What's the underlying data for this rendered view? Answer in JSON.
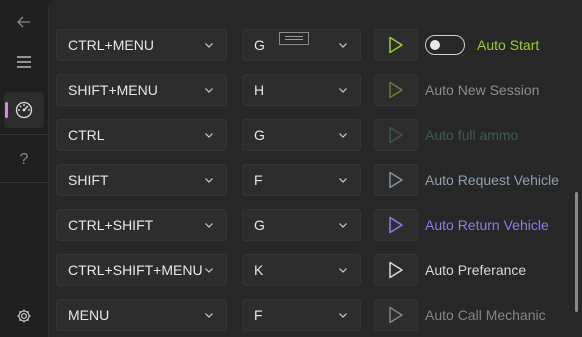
{
  "nav": {
    "back_icon": "back-arrow-icon",
    "menu_icon": "hamburger-menu-icon",
    "game_icon": "game-gauge-icon",
    "help_label": "?",
    "settings_icon": "gear-icon"
  },
  "window": {
    "close_icon": "close-icon",
    "close_label": "✕"
  },
  "rows": [
    {
      "modifier": "CTRL+MENU",
      "key": "G",
      "label": "Auto Start",
      "play_color": "#9acd32",
      "label_color": "#9acd32",
      "play_state": "active",
      "has_toggle": true,
      "toggle_on": false
    },
    {
      "modifier": "SHIFT+MENU",
      "key": "H",
      "label": "Auto New Session",
      "play_color": "#6b7a35",
      "label_color": "#8a8f96",
      "play_state": "dim"
    },
    {
      "modifier": "CTRL",
      "key": "G",
      "label": "Auto full ammo",
      "play_color": "#3b5552",
      "label_color": "#3f5a57",
      "play_state": "disabled"
    },
    {
      "modifier": "SHIFT",
      "key": "F",
      "label": "Auto Request Vehicle",
      "play_color": "#7d93a7",
      "label_color": "#90a0b0",
      "play_state": "normal"
    },
    {
      "modifier": "CTRL+SHIFT",
      "key": "G",
      "label": "Auto Return Vehicle",
      "play_color": "#8e7ce8",
      "label_color": "#8e7ce8",
      "play_state": "active"
    },
    {
      "modifier": "CTRL+SHIFT+MENU",
      "key": "K",
      "label": "Auto Preferance",
      "play_color": "#d8d8d8",
      "label_color": "#d8d8d8",
      "play_state": "normal"
    },
    {
      "modifier": "MENU",
      "key": "F",
      "label": "Auto Call Mechanic",
      "play_color": "#858585",
      "label_color": "#858585",
      "play_state": "dim"
    }
  ]
}
